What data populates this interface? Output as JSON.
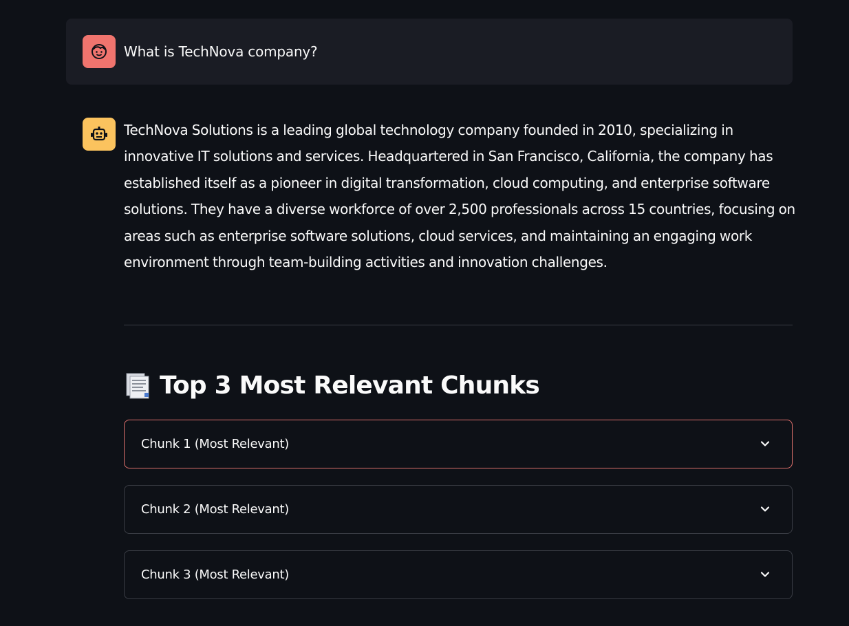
{
  "user_message": {
    "text": "What is TechNova company?",
    "avatar_icon": "user-face-icon",
    "avatar_color": "#f0746e"
  },
  "assistant_message": {
    "text": "TechNova Solutions is a leading global technology company founded in 2010, specializing in innovative IT solutions and services. Headquartered in San Francisco, California, the company has established itself as a pioneer in digital transformation, cloud computing, and enterprise software solutions. They have a diverse workforce of over 2,500 professionals across 15 countries, focusing on areas such as enterprise software solutions, cloud services, and maintaining an engaging work environment through team-building activities and innovation challenges.",
    "avatar_icon": "robot-icon",
    "avatar_color": "#fbc35e"
  },
  "chunks_section": {
    "title": "Top 3 Most Relevant Chunks",
    "title_icon": "document-icon",
    "expanders": [
      {
        "label": "Chunk 1 (Most Relevant)"
      },
      {
        "label": "Chunk 2 (Most Relevant)"
      },
      {
        "label": "Chunk 3 (Most Relevant)"
      }
    ]
  },
  "colors": {
    "background": "#0e1117",
    "focus_border": "#e0716d"
  }
}
